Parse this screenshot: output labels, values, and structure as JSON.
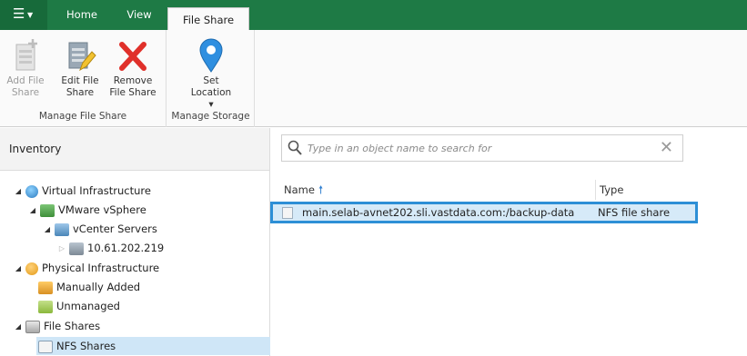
{
  "ribbon_tabs": {
    "home": "Home",
    "view": "View",
    "file_share": "File Share"
  },
  "ribbon": {
    "manage_file_share": {
      "label": "Manage File Share",
      "add": [
        "Add File",
        "Share"
      ],
      "edit": [
        "Edit File",
        "Share"
      ],
      "remove": [
        "Remove",
        "File Share"
      ]
    },
    "manage_storage": {
      "label": "Manage Storage",
      "set_location": [
        "Set",
        "Location ▾"
      ]
    }
  },
  "inventory": {
    "title": "Inventory",
    "tree": {
      "virtual_infrastructure": "Virtual Infrastructure",
      "vmware_vsphere": "VMware vSphere",
      "vcenter_servers": "vCenter Servers",
      "host": "10.61.202.219",
      "physical_infrastructure": "Physical Infrastructure",
      "manually_added": "Manually Added",
      "unmanaged": "Unmanaged",
      "file_shares": "File Shares",
      "nfs_shares": "NFS Shares"
    }
  },
  "search": {
    "placeholder": "Type in an object name to search for"
  },
  "table": {
    "columns": {
      "name": "Name",
      "type": "Type"
    },
    "rows": [
      {
        "name": "main.selab-avnet202.sli.vastdata.com:/backup-data",
        "type": "NFS file share"
      }
    ]
  },
  "colors": {
    "accent_green": "#1e7a45",
    "selection_blue": "#2d8fd6"
  }
}
